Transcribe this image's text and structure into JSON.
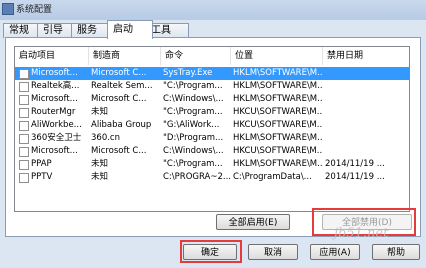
{
  "window": {
    "title": "系统配置"
  },
  "tabs": [
    {
      "label": "常规"
    },
    {
      "label": "引导"
    },
    {
      "label": "服务"
    },
    {
      "label": "启动",
      "active": true
    },
    {
      "label": "工具"
    }
  ],
  "table": {
    "columns": [
      "启动项目",
      "制造商",
      "命令",
      "位置",
      "禁用日期"
    ],
    "rows": [
      {
        "item": "Microsoft...",
        "maker": "Microsoft C...",
        "command": "SysTray.Exe",
        "location": "HKLM\\SOFTWARE\\M...",
        "date": "",
        "checked": false,
        "selected": true
      },
      {
        "item": "Realtek高...",
        "maker": "Realtek Sem...",
        "command": "\"C:\\Program...",
        "location": "HKLM\\SOFTWARE\\M...",
        "date": "",
        "checked": false
      },
      {
        "item": "Microsoft...",
        "maker": "Microsoft C...",
        "command": "C:\\Windows\\...",
        "location": "HKLM\\SOFTWARE\\M...",
        "date": "",
        "checked": false
      },
      {
        "item": "RouterMgr",
        "maker": "未知",
        "command": "\"C:\\Program...",
        "location": "HKCU\\SOFTWARE\\M...",
        "date": "",
        "checked": false
      },
      {
        "item": "AliWorkbe...",
        "maker": "Alibaba Group",
        "command": "\"G:\\AliWork...",
        "location": "HKCU\\SOFTWARE\\M...",
        "date": "",
        "checked": false
      },
      {
        "item": "360安全卫士",
        "maker": "360.cn",
        "command": "\"D:\\Program...",
        "location": "HKLM\\SOFTWARE\\M...",
        "date": "",
        "checked": false
      },
      {
        "item": "Microsoft...",
        "maker": "Microsoft C...",
        "command": "C:\\Windows\\...",
        "location": "HKCU\\SOFTWARE\\M...",
        "date": "",
        "checked": false
      },
      {
        "item": "PPAP",
        "maker": "未知",
        "command": "\"C:\\Program...",
        "location": "HKLM\\SOFTWARE\\M...",
        "date": "2014/11/19 ...",
        "checked": false
      },
      {
        "item": "PPTV",
        "maker": "未知",
        "command": "C:\\PROGRA~2...",
        "location": "C:\\ProgramData\\...",
        "date": "2014/11/19 ...",
        "checked": false
      }
    ]
  },
  "buttons": {
    "enable_all": "全部启用(E)",
    "disable_all": "全部禁用(D)",
    "ok": "确定",
    "cancel": "取消",
    "apply": "应用(A)",
    "help": "帮助"
  },
  "watermark": "jb51.net"
}
